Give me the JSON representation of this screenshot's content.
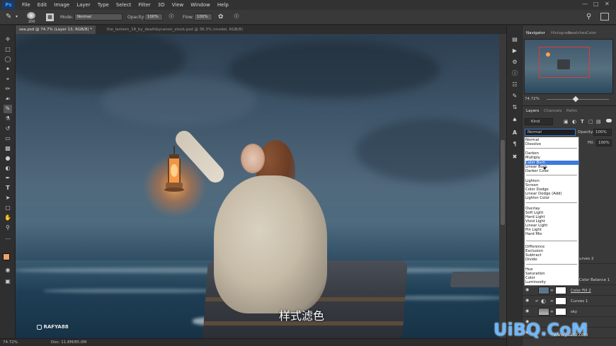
{
  "menubar": {
    "app_logo": "Ps",
    "items": [
      "File",
      "Edit",
      "Image",
      "Layer",
      "Type",
      "Select",
      "Filter",
      "3D",
      "View",
      "Window",
      "Help"
    ]
  },
  "options": {
    "brush_size": "200",
    "mode_label": "Mode:",
    "mode_value": "Normal",
    "opacity_label": "Opacity:",
    "opacity_value": "100%",
    "flow_label": "Flow:",
    "flow_value": "100%"
  },
  "doc_tabs": [
    {
      "label": "sea.psd @ 74.7% (Layer 13, RGB/8) *",
      "active": true
    },
    {
      "label": "the_lantern_18_by_deathbycanon_stock.psd @ 36.3% (model, RGB/8)",
      "active": false
    }
  ],
  "canvas": {
    "watermark": "RAFYA88",
    "subtitle": "样式滤色"
  },
  "status": {
    "zoom": "74.72%",
    "doc": "Doc: 11.8M/85.0M"
  },
  "navigator": {
    "tabs": [
      "Navigator",
      "Histogram",
      "Swatches",
      "Color"
    ],
    "zoom": "74.72%"
  },
  "layers": {
    "tabs": [
      "Layers",
      "Channels",
      "Paths"
    ],
    "kind": "Kind",
    "blend_value": "Normal",
    "opacity_label": "Opacity:",
    "opacity_value": "100%",
    "fill_label": "Fill:",
    "fill_value": "100%",
    "rows": [
      {
        "name": "urves 2"
      },
      {
        "name": "Color Balance 1"
      },
      {
        "name": "Color Fill 2"
      },
      {
        "name": "Curves 1"
      },
      {
        "name": "sky"
      }
    ]
  },
  "blend_modes": {
    "groups": [
      [
        "Normal",
        "Dissolve"
      ],
      [
        "Darken",
        "Multiply",
        "Color Burn",
        "Linear Burn",
        "Darker Color"
      ],
      [
        "Lighten",
        "Screen",
        "Color Dodge",
        "Linear Dodge (Add)",
        "Lighter Color"
      ],
      [
        "Overlay",
        "Soft Light",
        "Hard Light",
        "Vivid Light",
        "Linear Light",
        "Pin Light",
        "Hard Mix"
      ],
      [
        "Difference",
        "Exclusion",
        "Subtract",
        "Divide"
      ],
      [
        "Hue",
        "Saturation",
        "Color",
        "Luminosity"
      ]
    ],
    "highlighted": "Color Burn"
  },
  "site_watermark": {
    "logo": "UiBQ.CoM",
    "sub": "www.psahz.com"
  },
  "colors": {
    "accent_highlight": "#3d7ad9",
    "nav_rect": "#e03a3a",
    "foreground_swatch": "#e9a36e"
  }
}
